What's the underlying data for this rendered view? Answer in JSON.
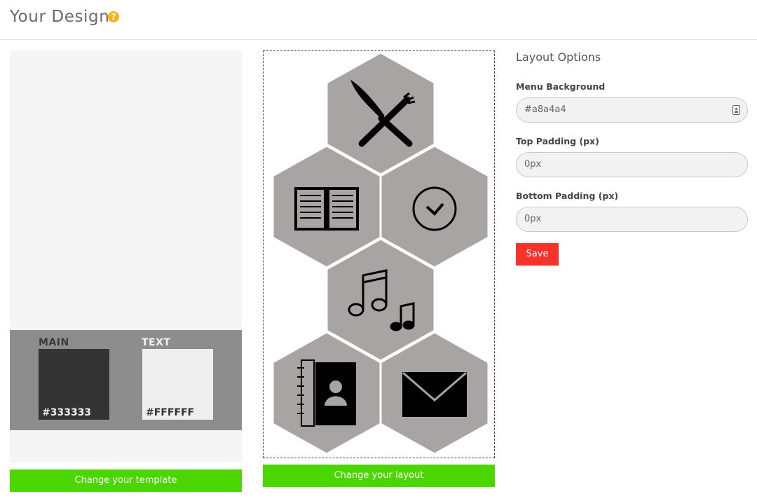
{
  "header": {
    "title": "Your Design",
    "help_icon": "question-circle-icon"
  },
  "template_preview": {
    "main_label": "MAIN",
    "main_color": "#333333",
    "text_label": "TEXT",
    "text_color": "#FFFFFF"
  },
  "layout_preview": {
    "hex_color": "#a8a4a4",
    "icons": [
      "knife-fork-icon",
      "open-book-icon",
      "badge-check-icon",
      "music-notes-icon",
      "address-book-icon",
      "envelope-icon"
    ]
  },
  "buttons": {
    "change_template": "Change your template",
    "change_layout": "Change your layout",
    "save": "Save"
  },
  "options": {
    "title": "Layout Options",
    "menu_background_label": "Menu Background",
    "menu_background_value": "#a8a4a4",
    "top_padding_label": "Top Padding (px)",
    "top_padding_value": "0px",
    "bottom_padding_label": "Bottom Padding (px)",
    "bottom_padding_value": "0px"
  }
}
